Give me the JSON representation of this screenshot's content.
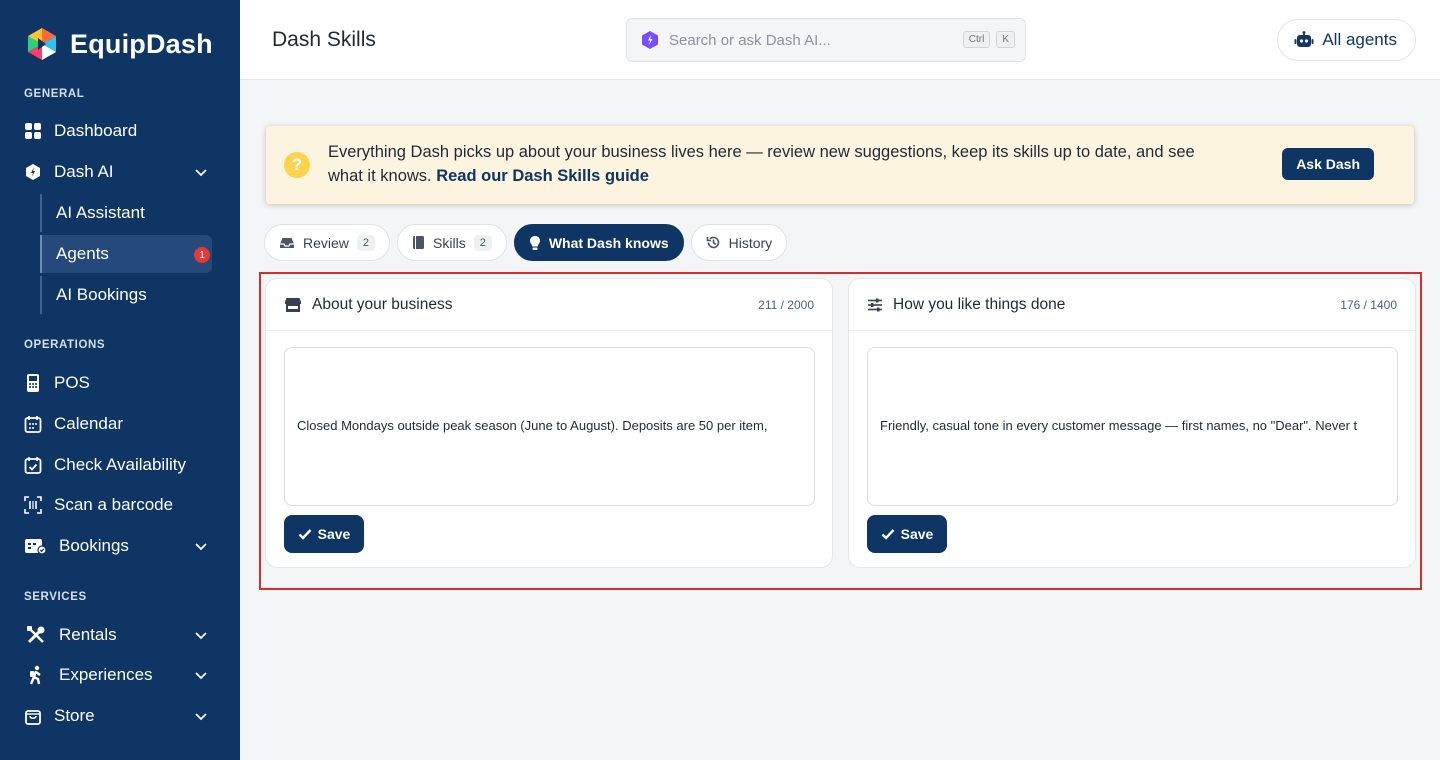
{
  "app": {
    "name": "EquipDash"
  },
  "sidebar": {
    "sections": {
      "general": "GENERAL",
      "operations": "OPERATIONS",
      "services": "SERVICES"
    },
    "items": {
      "dashboard": "Dashboard",
      "dash_ai": "Dash AI",
      "ai_assistant": "AI Assistant",
      "agents": "Agents",
      "agents_badge": "1",
      "ai_bookings": "AI Bookings",
      "pos": "POS",
      "calendar": "Calendar",
      "check_availability": "Check Availability",
      "scan_barcode": "Scan a barcode",
      "bookings": "Bookings",
      "rentals": "Rentals",
      "experiences": "Experiences",
      "store": "Store"
    }
  },
  "header": {
    "title": "Dash Skills",
    "search_placeholder": "Search or ask Dash AI...",
    "kbd_ctrl": "Ctrl",
    "kbd_k": "K",
    "all_agents": "All agents"
  },
  "banner": {
    "text": "Everything Dash picks up about your business lives here — review new suggestions, keep its skills up to date, and see what it knows.",
    "link": "Read our Dash Skills guide",
    "button": "Ask Dash"
  },
  "tabs": [
    {
      "label": "Review",
      "count": "2"
    },
    {
      "label": "Skills",
      "count": "2"
    },
    {
      "label": "What Dash knows",
      "count": ""
    },
    {
      "label": "History",
      "count": ""
    }
  ],
  "cards": {
    "business": {
      "title": "About your business",
      "count": "211 / 2000",
      "text": "Closed Mondays outside peak season (June to August). Deposits are 50 per item,",
      "save": "Save"
    },
    "preferences": {
      "title": "How you like things done",
      "count": "176 / 1400",
      "text": "Friendly, casual tone in every customer message — first names, no \"Dear\". Never t",
      "save": "Save"
    }
  },
  "colors": {
    "sidebar": "#0e3563",
    "accent": "#0e3563",
    "banner": "#fdf4e0",
    "highlight": "#d32f2f",
    "badge": "#e53935"
  }
}
